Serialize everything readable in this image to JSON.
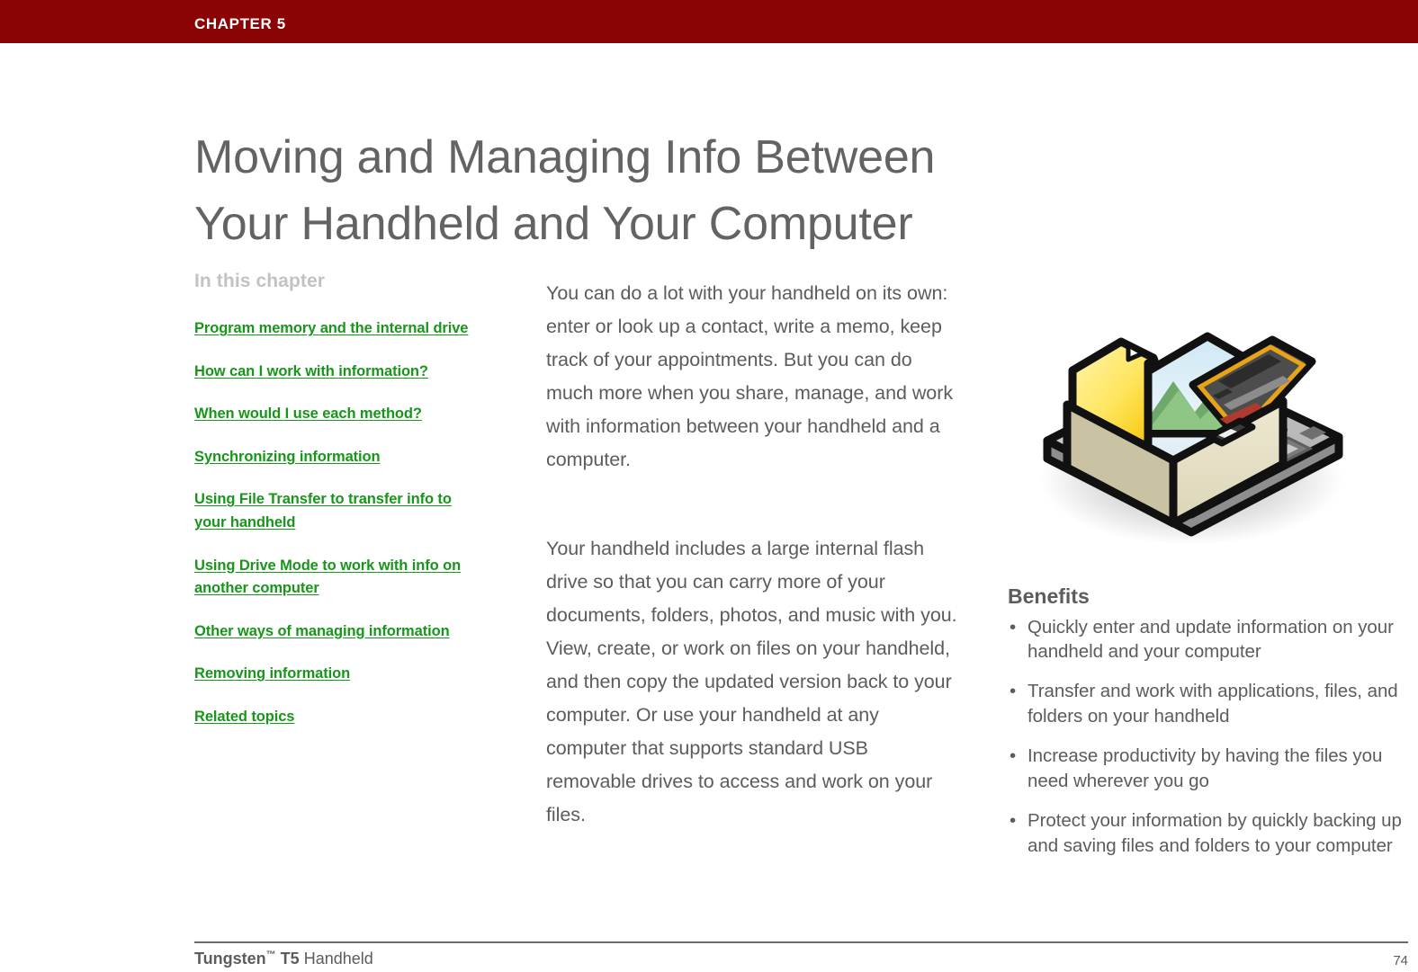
{
  "header": {
    "chapter_label": "CHAPTER 5",
    "bar_color": "#8B0304"
  },
  "title": {
    "line1": "Moving and Managing Info Between",
    "line2": "Your Handheld and Your Computer",
    "full": "Moving and Managing Info Between Your Handheld and Your Computer",
    "color": "#636363"
  },
  "toc": {
    "heading": "In this chapter",
    "heading_color": "#C2C2C2",
    "link_color": "#18961B",
    "items": [
      {
        "label": "Program memory and the internal drive"
      },
      {
        "label": "How can I work with information?"
      },
      {
        "label": "When would I use each method?"
      },
      {
        "label": "Synchronizing information"
      },
      {
        "label": "Using File Transfer to transfer info to your handheld"
      },
      {
        "label": "Using Drive Mode to work with info on another computer"
      },
      {
        "label": "Other ways of managing information"
      },
      {
        "label": "Removing information"
      },
      {
        "label": "Related topics"
      }
    ]
  },
  "body": {
    "text_color": "#5C5C5C",
    "paragraphs": [
      "You can do a lot with your handheld on its own: enter or look up a contact, write a memo, keep track of your appointments. But you can do much more when you share, manage, and work with information between your handheld and a computer.",
      "Your handheld includes a large internal flash drive so that you can carry more of your documents, folders, photos, and music with you. View, create, or work on files on your handheld, and then copy the updated version back to your computer. Or use your handheld at any computer that supports standard USB removable drives to access and work on your files."
    ]
  },
  "illustration": {
    "name": "handheld-with-file-box-illustration",
    "description": "Isometric handheld device with a box of files, folder, photo and document"
  },
  "benefits": {
    "heading": "Benefits",
    "bullet_glyph": "•",
    "items": [
      "Quickly enter and update information on your handheld and your computer",
      "Transfer and work with applications, files, and folders on your handheld",
      "Increase productivity by having the files you need wherever you go",
      "Protect your information by quickly backing up and saving files and folders to your computer"
    ]
  },
  "footer": {
    "product_brand": "Tungsten",
    "trademark": "™",
    "product_model": "T5",
    "product_type": "Handheld",
    "page_number": "74"
  }
}
